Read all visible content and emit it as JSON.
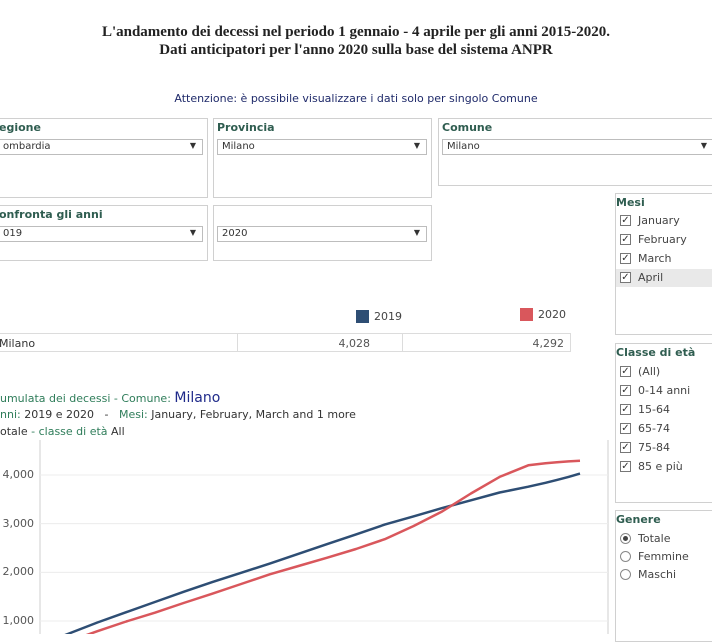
{
  "title_line1": "L'andamento dei decessi nel periodo 1 gennaio - 4 aprile per gli anni 2015-2020.",
  "title_line2": "Dati anticipatori per l'anno 2020 sulla base del sistema ANPR",
  "notice": "Attenzione: è possibile visualizzare i dati solo per singolo Comune",
  "filters": {
    "regione": {
      "label": "egione",
      "value": "ombardia"
    },
    "provincia": {
      "label": "Provincia",
      "value": "Milano"
    },
    "comune": {
      "label": "Comune",
      "value": "Milano"
    },
    "confronta": {
      "label": "onfronta gli anni",
      "value_a": "019",
      "value_b": "2020"
    }
  },
  "mesi": {
    "title": "Mesi",
    "items": [
      {
        "label": "January",
        "checked": true
      },
      {
        "label": "February",
        "checked": true
      },
      {
        "label": "March",
        "checked": true
      },
      {
        "label": "April",
        "checked": true
      }
    ]
  },
  "classe": {
    "title": "Classe di età",
    "items": [
      {
        "label": "(All)",
        "checked": true
      },
      {
        "label": "0-14 anni",
        "checked": true
      },
      {
        "label": "15-64",
        "checked": true
      },
      {
        "label": "65-74",
        "checked": true
      },
      {
        "label": "75-84",
        "checked": true
      },
      {
        "label": "85 e più",
        "checked": true
      }
    ]
  },
  "genere": {
    "title": "Genere",
    "items": [
      {
        "label": "Totale",
        "selected": true
      },
      {
        "label": "Femmine",
        "selected": false
      },
      {
        "label": "Maschi",
        "selected": false
      }
    ]
  },
  "legend": {
    "y2019": "2019",
    "y2020": "2020",
    "color2019": "#2e4e74",
    "color2020": "#d9575c"
  },
  "table_row": {
    "name": "Milano",
    "v2019": "4,028",
    "v2020": "4,292"
  },
  "chart_header": {
    "line1_label": "umulata dei decessi -",
    "line1_comune_label": "Comune:",
    "line1_comune_value": "Milano",
    "line2_label": "nni:",
    "line2_value": "2019 e 2020",
    "line2_dash": "-",
    "line2_mesi_label": "Mesi:",
    "line2_mesi_value": "January, February, March and 1 more",
    "line3_label": "otale",
    "line3_dash": "-",
    "line3_classe_label": "classe di età",
    "line3_classe_value": "All"
  },
  "chart_data": {
    "type": "line",
    "yticks": [
      "1,000",
      "2,000",
      "3,000",
      "4,000"
    ],
    "ylim": [
      0,
      4300
    ],
    "x": [
      0,
      5,
      10,
      15,
      20,
      25,
      30,
      35,
      40,
      45,
      50,
      55,
      60,
      65,
      70,
      75,
      80,
      85,
      88,
      90,
      92,
      94
    ],
    "series": [
      {
        "name": "2019",
        "color": "#2e4e74",
        "values": [
          500,
          742,
          970,
          1180,
          1390,
          1600,
          1800,
          1990,
          2180,
          2380,
          2580,
          2780,
          2980,
          3150,
          3320,
          3480,
          3640,
          3760,
          3840,
          3900,
          3960,
          4028
        ]
      },
      {
        "name": "2020",
        "color": "#d9575c",
        "values": [
          400,
          580,
          790,
          990,
          1170,
          1370,
          1560,
          1760,
          1960,
          2130,
          2300,
          2480,
          2680,
          2950,
          3250,
          3620,
          3960,
          4200,
          4240,
          4260,
          4280,
          4292
        ]
      }
    ]
  }
}
